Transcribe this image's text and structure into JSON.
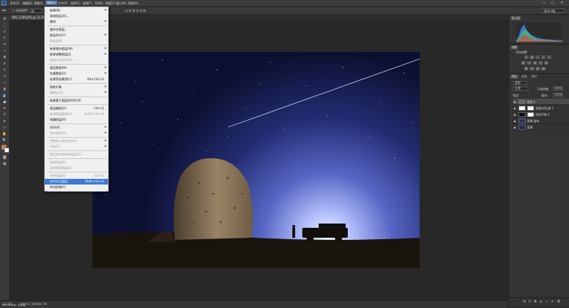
{
  "menubar": {
    "logo": "Ps",
    "items": [
      "文件(F)",
      "编辑(E)",
      "图像(I)",
      "图层(L)",
      "文字(Y)",
      "选择(S)",
      "滤镜(T)",
      "3D(D)",
      "视图(V)",
      "窗口(W)",
      "帮助(H)"
    ],
    "active_index": 3,
    "window_controls": [
      "—",
      "▢",
      "✕"
    ]
  },
  "options_bar": {
    "auto_select_label": "自动选择：",
    "group_value": "组",
    "transform_label": "显示变换控件",
    "workspace_label": "基本功能"
  },
  "document_tab": {
    "title": "IMG_1189.JPG @ 33.3% (图层 1, RGB/8)"
  },
  "layer_menu": {
    "items": [
      {
        "label": "新建(N)",
        "arrow": true
      },
      {
        "label": "复制图层(D)..."
      },
      {
        "label": "删除",
        "arrow": true
      },
      {
        "sep": true
      },
      {
        "label": "重命名图层..."
      },
      {
        "label": "图层样式(Y)",
        "arrow": true
      },
      {
        "label": "智能滤镜",
        "disabled": true
      },
      {
        "sep": true
      },
      {
        "label": "新建填充图层(W)",
        "arrow": true
      },
      {
        "label": "新建调整图层(J)",
        "arrow": true
      },
      {
        "label": "图层内容选项(O)...",
        "disabled": true
      },
      {
        "sep": true
      },
      {
        "label": "图层蒙版(M)",
        "arrow": true
      },
      {
        "label": "矢量蒙版(V)",
        "arrow": true
      },
      {
        "label": "创建剪贴蒙版(C)",
        "shortcut": "Alt+Ctrl+G"
      },
      {
        "sep": true
      },
      {
        "label": "智能对象",
        "arrow": true
      },
      {
        "label": "栅格化(Z)",
        "arrow": true,
        "disabled": true
      },
      {
        "sep": true
      },
      {
        "label": "新建基于图层的切片(B)"
      },
      {
        "sep": true
      },
      {
        "label": "图层编组(G)",
        "shortcut": "Ctrl+G"
      },
      {
        "label": "取消图层编组(U)",
        "shortcut": "Shift+Ctrl+G",
        "disabled": true
      },
      {
        "label": "隐藏图层(R)"
      },
      {
        "sep": true
      },
      {
        "label": "排列(A)",
        "arrow": true
      },
      {
        "label": "合并形状(H)",
        "arrow": true,
        "disabled": true
      },
      {
        "sep": true
      },
      {
        "label": "将图层与选区对齐(I)",
        "arrow": true,
        "disabled": true
      },
      {
        "label": "分布(T)",
        "arrow": true,
        "disabled": true
      },
      {
        "sep": true
      },
      {
        "label": "锁定组内的所有图层(X)...",
        "disabled": true
      },
      {
        "sep": true
      },
      {
        "label": "链接图层(K)",
        "disabled": true
      },
      {
        "label": "选择链接图层(S)",
        "disabled": true
      },
      {
        "sep": true
      },
      {
        "label": "合并图层(E)",
        "shortcut": "Ctrl+E",
        "disabled": true
      },
      {
        "label": "合并可见图层",
        "shortcut": "Shift+Ctrl+E",
        "highlighted": true
      },
      {
        "label": "拼合图像(F)"
      },
      {
        "sep": true
      },
      {
        "label": "修边",
        "arrow": true
      }
    ]
  },
  "status_bar": {
    "zoom": "33.33%",
    "doc_size": "文档:91.1M/394.7M",
    "mini_bridge": "Mini Bridge",
    "timeline": "时间轴"
  },
  "panels": {
    "histogram_tab": "直方图",
    "adjustments_tab": "调整",
    "adjustments_label": "添加调整",
    "layers_tab": "图层",
    "channels_tab": "通道",
    "paths_tab": "路径",
    "kind_label": "类型",
    "blend_mode": "正常",
    "opacity_label": "不透明度:",
    "opacity_value": "100%",
    "lock_label": "锁定:",
    "fill_label": "填充:",
    "fill_value": "100%",
    "layers": [
      {
        "name": "图层 1",
        "selected": true,
        "thumb": "#6a6a6a"
      },
      {
        "name": "亮度/对比度 1",
        "thumb": "#ffffff",
        "mask": true
      },
      {
        "name": "色彩平衡 1",
        "thumb": "#111111",
        "mask": true
      },
      {
        "name": "背景 副本",
        "thumb": "#223366"
      },
      {
        "name": "背景",
        "thumb": "#1e2a55"
      }
    ]
  },
  "colors": {
    "accent": "#3d7ad6",
    "foreground_swatch": "#e0772b",
    "background_swatch": "#ffffff"
  }
}
